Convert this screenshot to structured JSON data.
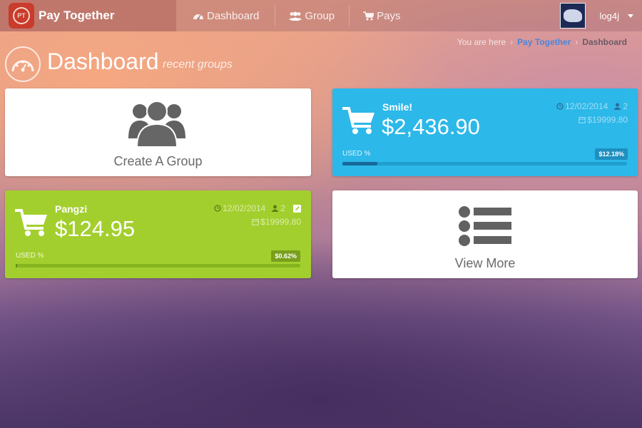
{
  "brand": {
    "logo_text": "PT",
    "name": "Pay Together"
  },
  "nav": [
    {
      "label": "Dashboard",
      "icon": "dashboard-icon"
    },
    {
      "label": "Group",
      "icon": "group-icon"
    },
    {
      "label": "Pays",
      "icon": "cart-icon"
    }
  ],
  "user": {
    "name": "log4j"
  },
  "breadcrumb": {
    "prefix": "You are here",
    "link": "Pay Together",
    "current": "Dashboard"
  },
  "page": {
    "title": "Dashboard",
    "subtitle": "recent groups"
  },
  "create_card": {
    "label": "Create A Group"
  },
  "view_card": {
    "label": "View More"
  },
  "groups": [
    {
      "name": "Smile!",
      "amount": "$2,436.90",
      "date": "12/02/2014",
      "members": "2",
      "budget": "$19999.80",
      "used_label": "USED %",
      "used_pct_text": "$12.18%",
      "used_fraction": 0.1218,
      "color": "#2cb8e9"
    },
    {
      "name": "Pangzi",
      "amount": "$124.95",
      "date": "12/02/2014",
      "members": "2",
      "budget": "$19999.80",
      "used_label": "USED %",
      "used_pct_text": "$0.62%",
      "used_fraction": 0.0062,
      "color": "#a3cf2e"
    }
  ]
}
